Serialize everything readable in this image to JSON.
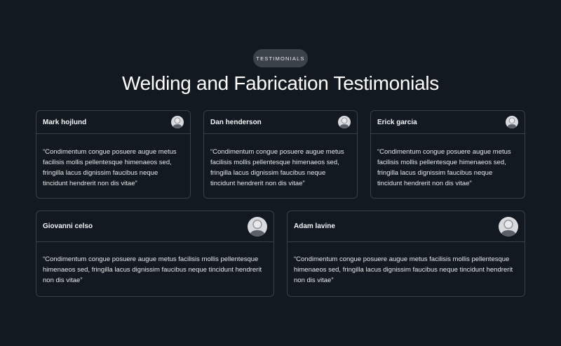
{
  "section": {
    "badge": "TESTIMONIALS",
    "title": "Welding and Fabrication Testimonials"
  },
  "testimonials": [
    {
      "name": "Mark hojlund",
      "quote": "“Condimentum congue posuere augue metus facilisis mollis pellentesque himenaeos sed, fringilla lacus dignissim faucibus neque tincidunt hendrerit non dis vitae”"
    },
    {
      "name": "Dan henderson",
      "quote": "“Condimentum congue posuere augue metus facilisis mollis pellentesque himenaeos sed, fringilla lacus dignissim faucibus neque tincidunt hendrerit non dis vitae”"
    },
    {
      "name": "Erick garcia",
      "quote": "“Condimentum congue posuere augue metus facilisis mollis pellentesque himenaeos sed, fringilla lacus dignissim faucibus neque tincidunt hendrerit non dis vitae”"
    },
    {
      "name": "Giovanni celso",
      "quote": "“Condimentum congue posuere augue metus facilisis mollis pellentesque himenaeos sed, fringilla lacus dignissim faucibus neque tincidunt hendrerit non dis vitae”"
    },
    {
      "name": "Adam lavine",
      "quote": "“Condimentum congue posuere augue metus facilisis mollis pellentesque himenaeos sed, fringilla lacus dignissim faucibus neque tincidunt hendrerit non dis vitae”"
    }
  ],
  "colors": {
    "background": "#131920",
    "card_border": "#3a4048",
    "badge_bg": "#3c424a",
    "text": "#ffffff"
  }
}
